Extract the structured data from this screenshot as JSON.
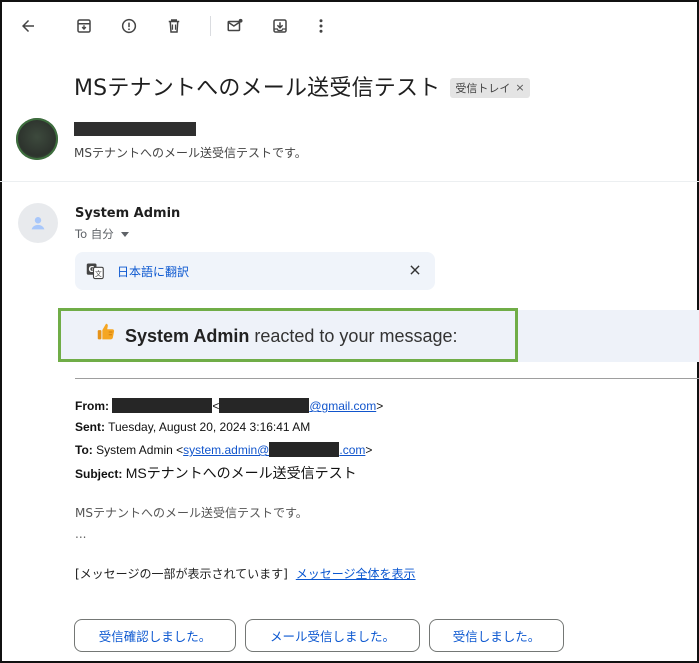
{
  "toolbar": {
    "icons": [
      "back-arrow-icon",
      "archive-icon",
      "report-spam-icon",
      "delete-icon",
      "mark-unread-icon",
      "move-to-icon",
      "more-vert-icon"
    ]
  },
  "thread": {
    "subject": "MSテナントへのメール送受信テスト",
    "label": "受信トレイ",
    "label_remove": "×"
  },
  "message1": {
    "snippet": "MSテナントへのメール送受信テストです。"
  },
  "message2": {
    "sender": "System Admin",
    "to_label": "To 自分",
    "translate_link": "日本語に翻訳",
    "translate_close": "×",
    "reaction": {
      "emoji": "thumbs-up-icon",
      "actor": "System Admin",
      "text": " reacted to your message:"
    },
    "quoted": {
      "from_label": "From:",
      "from_lt": "<",
      "from_email_suffix": "@gmail.com",
      "from_gt": ">",
      "sent_label": "Sent:",
      "sent_value": "Tuesday, August 20, 2024 3:16:41 AM",
      "to_label": "To:",
      "to_name": "System Admin <",
      "to_email_prefix": "system.admin@",
      "to_email_suffix": ".com",
      "to_gt": ">",
      "subject_label": "Subject:",
      "subject_value": "MSテナントへのメール送受信テスト"
    },
    "body": "MSテナントへのメール送受信テストです。",
    "ellipsis": "...",
    "clipped_notice": "[メッセージの一部が表示されています]",
    "view_entire": "メッセージ全体を表示"
  },
  "smart_replies": [
    "受信確認しました。",
    "メール受信しました。",
    "受信しました。"
  ],
  "colors": {
    "link": "#0b57d0",
    "highlight_border": "#70ad47",
    "reaction_bg": "#eef2f9",
    "translate_bg": "#f0f4fa"
  }
}
